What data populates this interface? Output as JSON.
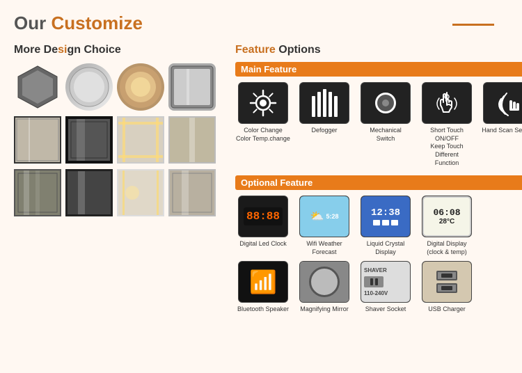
{
  "page": {
    "title_prefix": "Our ",
    "title_highlight": "Customize",
    "header_line": true
  },
  "left": {
    "section_title_prefix": "More De",
    "section_title_highlight": "si",
    "section_title_suffix": "gn Choice",
    "shapes": [
      {
        "type": "hex",
        "label": "Hexagon"
      },
      {
        "type": "circle",
        "label": "Circle"
      },
      {
        "type": "oval-warm",
        "label": "Oval Warm"
      },
      {
        "type": "square-round",
        "label": "Rectangle"
      }
    ],
    "row2": [
      {
        "type": "frame-dark",
        "label": ""
      },
      {
        "type": "frame-black",
        "label": ""
      },
      {
        "type": "led-white",
        "label": ""
      },
      {
        "type": "room-scene",
        "label": ""
      }
    ],
    "row3": [
      {
        "type": "frame-dark2",
        "label": ""
      },
      {
        "type": "frame-black2",
        "label": ""
      },
      {
        "type": "led-white2",
        "label": ""
      },
      {
        "type": "room-scene2",
        "label": ""
      }
    ]
  },
  "right": {
    "section_title_prefix": "",
    "section_title_highlight": "Feature",
    "section_title_suffix": " Options",
    "main_feature_band": "Main Feature",
    "main_features": [
      {
        "id": "color-change",
        "icon_type": "sun",
        "label": "Color Change\nColor Temp.change"
      },
      {
        "id": "defogger",
        "icon_type": "defog",
        "label": "Defogger"
      },
      {
        "id": "mechanical-switch",
        "icon_type": "mech",
        "label": "Mechanical\nSwitch"
      },
      {
        "id": "short-touch",
        "icon_type": "touch",
        "label": "Short Touch ON/OFF\nKeep Touch Different\nFunction"
      },
      {
        "id": "hand-scan",
        "icon_type": "hand",
        "label": "Hand Scan Sensor"
      }
    ],
    "optional_feature_band": "Optional Feature",
    "optional_features_row1": [
      {
        "id": "digital-led-clock",
        "icon_type": "led-clock",
        "label": "Digital Led Clock"
      },
      {
        "id": "wifi-weather",
        "icon_type": "weather",
        "label": "Wifi Weather Forecast"
      },
      {
        "id": "lcd",
        "icon_type": "lcd",
        "label": "Liquid Crystal Display"
      },
      {
        "id": "digital-display",
        "icon_type": "digital",
        "label": "Digital Display\n(clock & temp)"
      }
    ],
    "optional_features_row2": [
      {
        "id": "bluetooth",
        "icon_type": "bluetooth",
        "label": "Bluetooth Speaker"
      },
      {
        "id": "magnifying",
        "icon_type": "magnify",
        "label": "Magnifying Mirror"
      },
      {
        "id": "shaver",
        "icon_type": "shaver",
        "label": "Shaver Socket"
      },
      {
        "id": "usb",
        "icon_type": "usb",
        "label": "USB Charger"
      }
    ]
  }
}
